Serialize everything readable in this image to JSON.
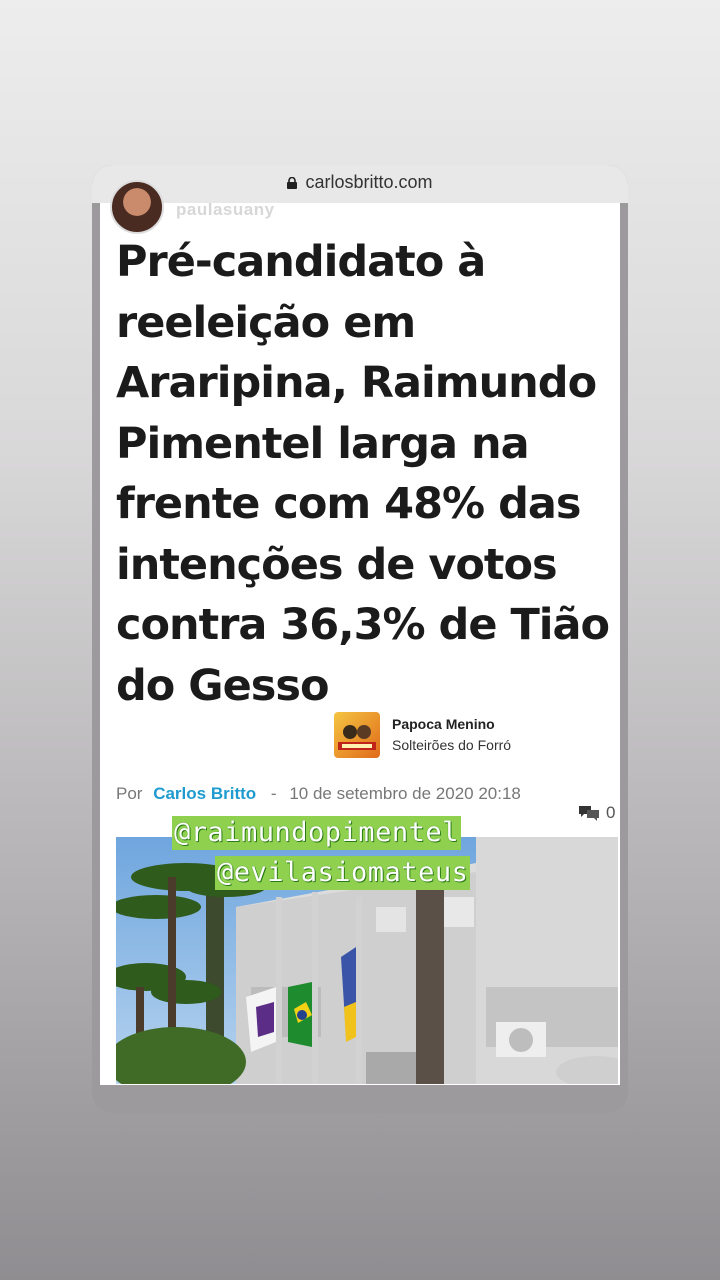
{
  "browser": {
    "url": "carlosbritto.com"
  },
  "story": {
    "username": "paulasuany"
  },
  "article": {
    "headline": "Pré-candidato à reeleição em Araripina, Raimundo Pimentel larga na frente com 48% das intenções de votos contra 36,3% de Tião do Gesso",
    "by_prefix": "Por",
    "author": "Carlos Britto",
    "separator": "-",
    "date": "10 de setembro de 2020 20:18",
    "comment_count": "0"
  },
  "music_sticker": {
    "title": "Papoca Menino",
    "artist": "Solteirões do Forró"
  },
  "mentions": [
    "@raimundopimentel",
    "@evilasiomateus"
  ],
  "icons": {
    "lock": "lock-icon",
    "comments": "comment-bubbles-icon"
  }
}
